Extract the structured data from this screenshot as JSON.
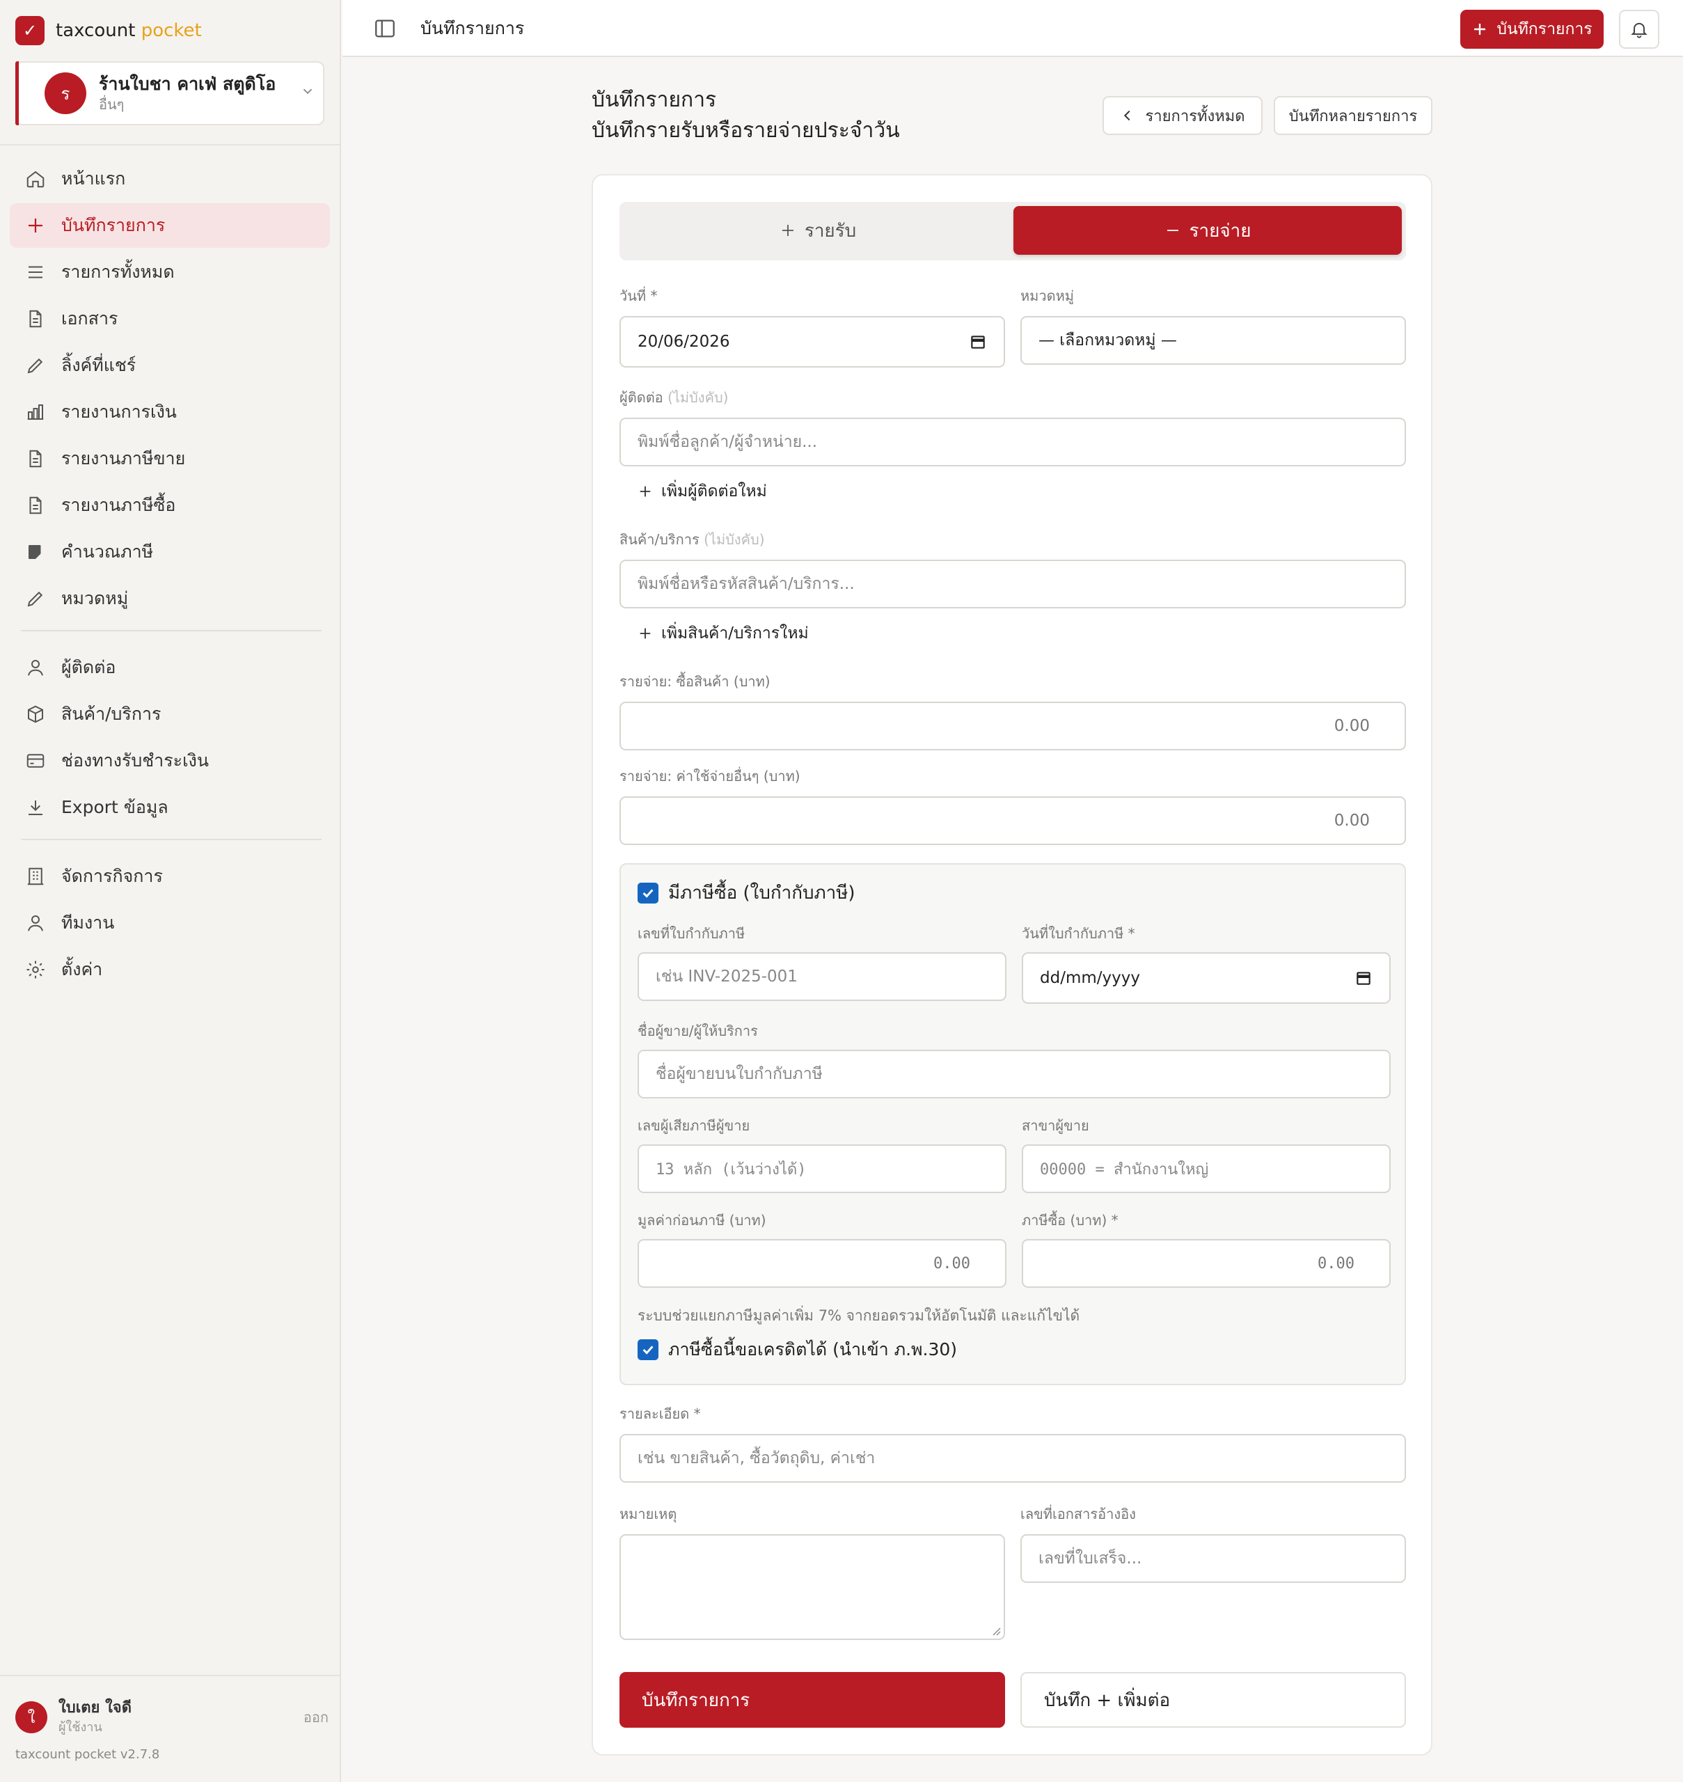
{
  "brand": {
    "name": "taxcount",
    "accent": "pocket"
  },
  "business": {
    "initial": "ร",
    "name": "ร้านใบชา คาเฟ่ สตูดิโอ",
    "type": "อื่นๆ"
  },
  "nav": {
    "home": "หน้าแรก",
    "record": "บันทึกรายการ",
    "all": "รายการทั้งหมด",
    "documents": "เอกสาร",
    "shared_links": "ลิ้งค์ที่แชร์",
    "finance_report": "รายงานการเงิน",
    "sales_tax_report": "รายงานภาษีขาย",
    "purchase_tax_report": "รายงานภาษีซื้อ",
    "tax_calc": "คำนวณภาษี",
    "categories": "หมวดหมู่",
    "contacts": "ผู้ติดต่อ",
    "products": "สินค้า/บริการ",
    "payment_channels": "ช่องทางรับชำระเงิน",
    "export": "Export ข้อมูล",
    "manage_business": "จัดการกิจการ",
    "team": "ทีมงาน",
    "settings": "ตั้งค่า"
  },
  "user": {
    "initial": "ใ",
    "name": "ใบเตย ใจดี",
    "role": "ผู้ใช้งาน",
    "logout": "ออก"
  },
  "version": "taxcount pocket v2.7.8",
  "topbar": {
    "title": "บันทึกรายการ",
    "add_button": "บันทึกรายการ"
  },
  "page": {
    "title": "บันทึกรายการ",
    "subtitle": "บันทึกรายรับหรือรายจ่ายประจำวัน",
    "all_button": "รายการทั้งหมด",
    "multi_button": "บันทึกหลายรายการ"
  },
  "form": {
    "income_tab": "รายรับ",
    "expense_tab": "รายจ่าย",
    "date_label": "วันที่ *",
    "date_value": "20/06/2026",
    "category_label": "หมวดหมู่",
    "category_value": "— เลือกหมวดหมู่ —",
    "contact_label": "ผู้ติดต่อ",
    "optional": "(ไม่บังคับ)",
    "contact_placeholder": "พิมพ์ชื่อลูกค้า/ผู้จำหน่าย...",
    "add_contact": "เพิ่มผู้ติดต่อใหม่",
    "product_label": "สินค้า/บริการ",
    "product_placeholder": "พิมพ์ชื่อหรือรหัสสินค้า/บริการ...",
    "add_product": "เพิ่มสินค้า/บริการใหม่",
    "expense_goods_label": "รายจ่าย: ซื้อสินค้า (บาท)",
    "expense_goods_value": "0.00",
    "expense_other_label": "รายจ่าย: ค่าใช้จ่ายอื่นๆ (บาท)",
    "expense_other_value": "0.00",
    "tax_checkbox_label": "มีภาษีซื้อ (ใบกำกับภาษี)",
    "invoice_no_label": "เลขที่ใบกำกับภาษี",
    "invoice_no_placeholder": "เช่น INV-2025-001",
    "invoice_date_label": "วันที่ใบกำกับภาษี *",
    "invoice_date_placeholder": "dd/mm/yyyy",
    "seller_name_label": "ชื่อผู้ขาย/ผู้ให้บริการ",
    "seller_name_placeholder": "ชื่อผู้ขายบนใบกำกับภาษี",
    "seller_tax_id_label": "เลขผู้เสียภาษีผู้ขาย",
    "seller_tax_id_placeholder": "13 หลัก (เว้นว่างได้)",
    "seller_branch_label": "สาขาผู้ขาย",
    "seller_branch_placeholder": "00000 = สำนักงานใหญ่",
    "pre_tax_label": "มูลค่าก่อนภาษี (บาท)",
    "pre_tax_value": "0.00",
    "purchase_tax_label": "ภาษีซื้อ (บาท) *",
    "purchase_tax_value": "0.00",
    "vat_hint": "ระบบช่วยแยกภาษีมูลค่าเพิ่ม 7% จากยอดรวมให้อัตโนมัติ และแก้ไขได้",
    "credit_checkbox_label": "ภาษีซื้อนี้ขอเครดิตได้ (นำเข้า ภ.พ.30)",
    "detail_label": "รายละเอียด *",
    "detail_placeholder": "เช่น ขายสินค้า, ซื้อวัตถุดิบ, ค่าเช่า",
    "note_label": "หมายเหตุ",
    "ref_label": "เลขที่เอกสารอ้างอิง",
    "ref_placeholder": "เลขที่ใบเสร็จ...",
    "save_button": "บันทึกรายการ",
    "save_more_button": "บันทึก + เพิ่มต่อ"
  },
  "colors": {
    "brand": "#b91c24",
    "checkbox": "#1565c0",
    "brand_accent": "#e8a21a"
  }
}
